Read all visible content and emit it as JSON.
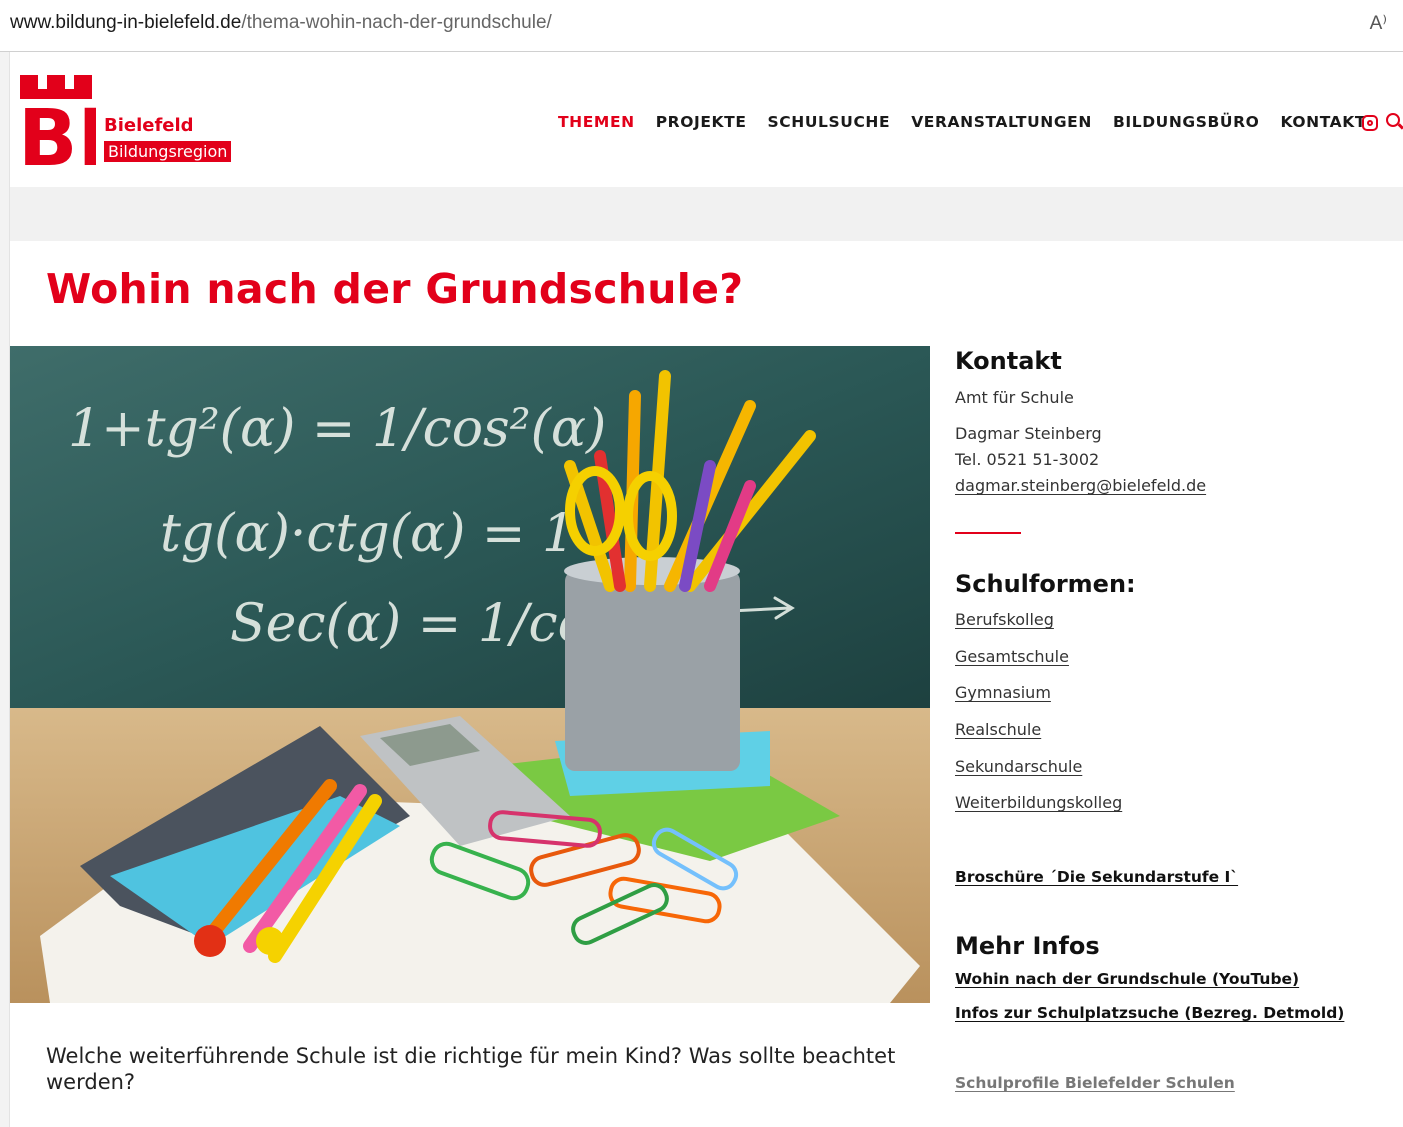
{
  "browser": {
    "url_host": "www.bildung-in-bielefeld.de",
    "url_path": "/thema-wohin-nach-der-grundschule/",
    "read_aloud_icon": "A⁾"
  },
  "logo": {
    "letters": "BI",
    "city": "Bielefeld",
    "region": "Bildungsregion"
  },
  "nav": {
    "items": [
      "THEMEN",
      "PROJEKTE",
      "SCHULSUCHE",
      "VERANSTALTUNGEN",
      "BILDUNGSBÜRO",
      "KONTAKT"
    ],
    "active": "THEMEN",
    "icons": [
      "instagram-icon",
      "search-icon"
    ]
  },
  "colors": {
    "brand_red": "#e2001a",
    "band_grey": "#f1f1f1"
  },
  "page": {
    "title": "Wohin nach der Grundschule?",
    "intro": "Welche weiterführende Schule ist die richtige für mein Kind? Was sollte beachtet werden?"
  },
  "hero": {
    "chalk_lines": [
      "1+tg²(α) = 1/cos²(α)",
      "tg(α)·ctg(α) = 1",
      "Sec(α) = 1/cosα"
    ]
  },
  "sidebar": {
    "contact_heading": "Kontakt",
    "office": "Amt für Schule",
    "person": "Dagmar Steinberg",
    "phone": "Tel. 0521 51-3002",
    "email": "dagmar.steinberg@bielefeld.de",
    "schulformen_heading": "Schulformen:",
    "schulformen": [
      "Berufskolleg",
      "Gesamtschule",
      "Gymnasium",
      "Realschule",
      "Sekundarschule",
      "Weiterbildungskolleg"
    ],
    "brochure": "Broschüre ´Die Sekundarstufe I`",
    "mehr_heading": "Mehr Infos",
    "mehr_links": [
      "Wohin nach der Grundschule (YouTube)",
      "Infos zur Schulplatzsuche (Bezreg. Detmold)"
    ],
    "profile_link": "Schulprofile Bielefelder Schulen"
  }
}
